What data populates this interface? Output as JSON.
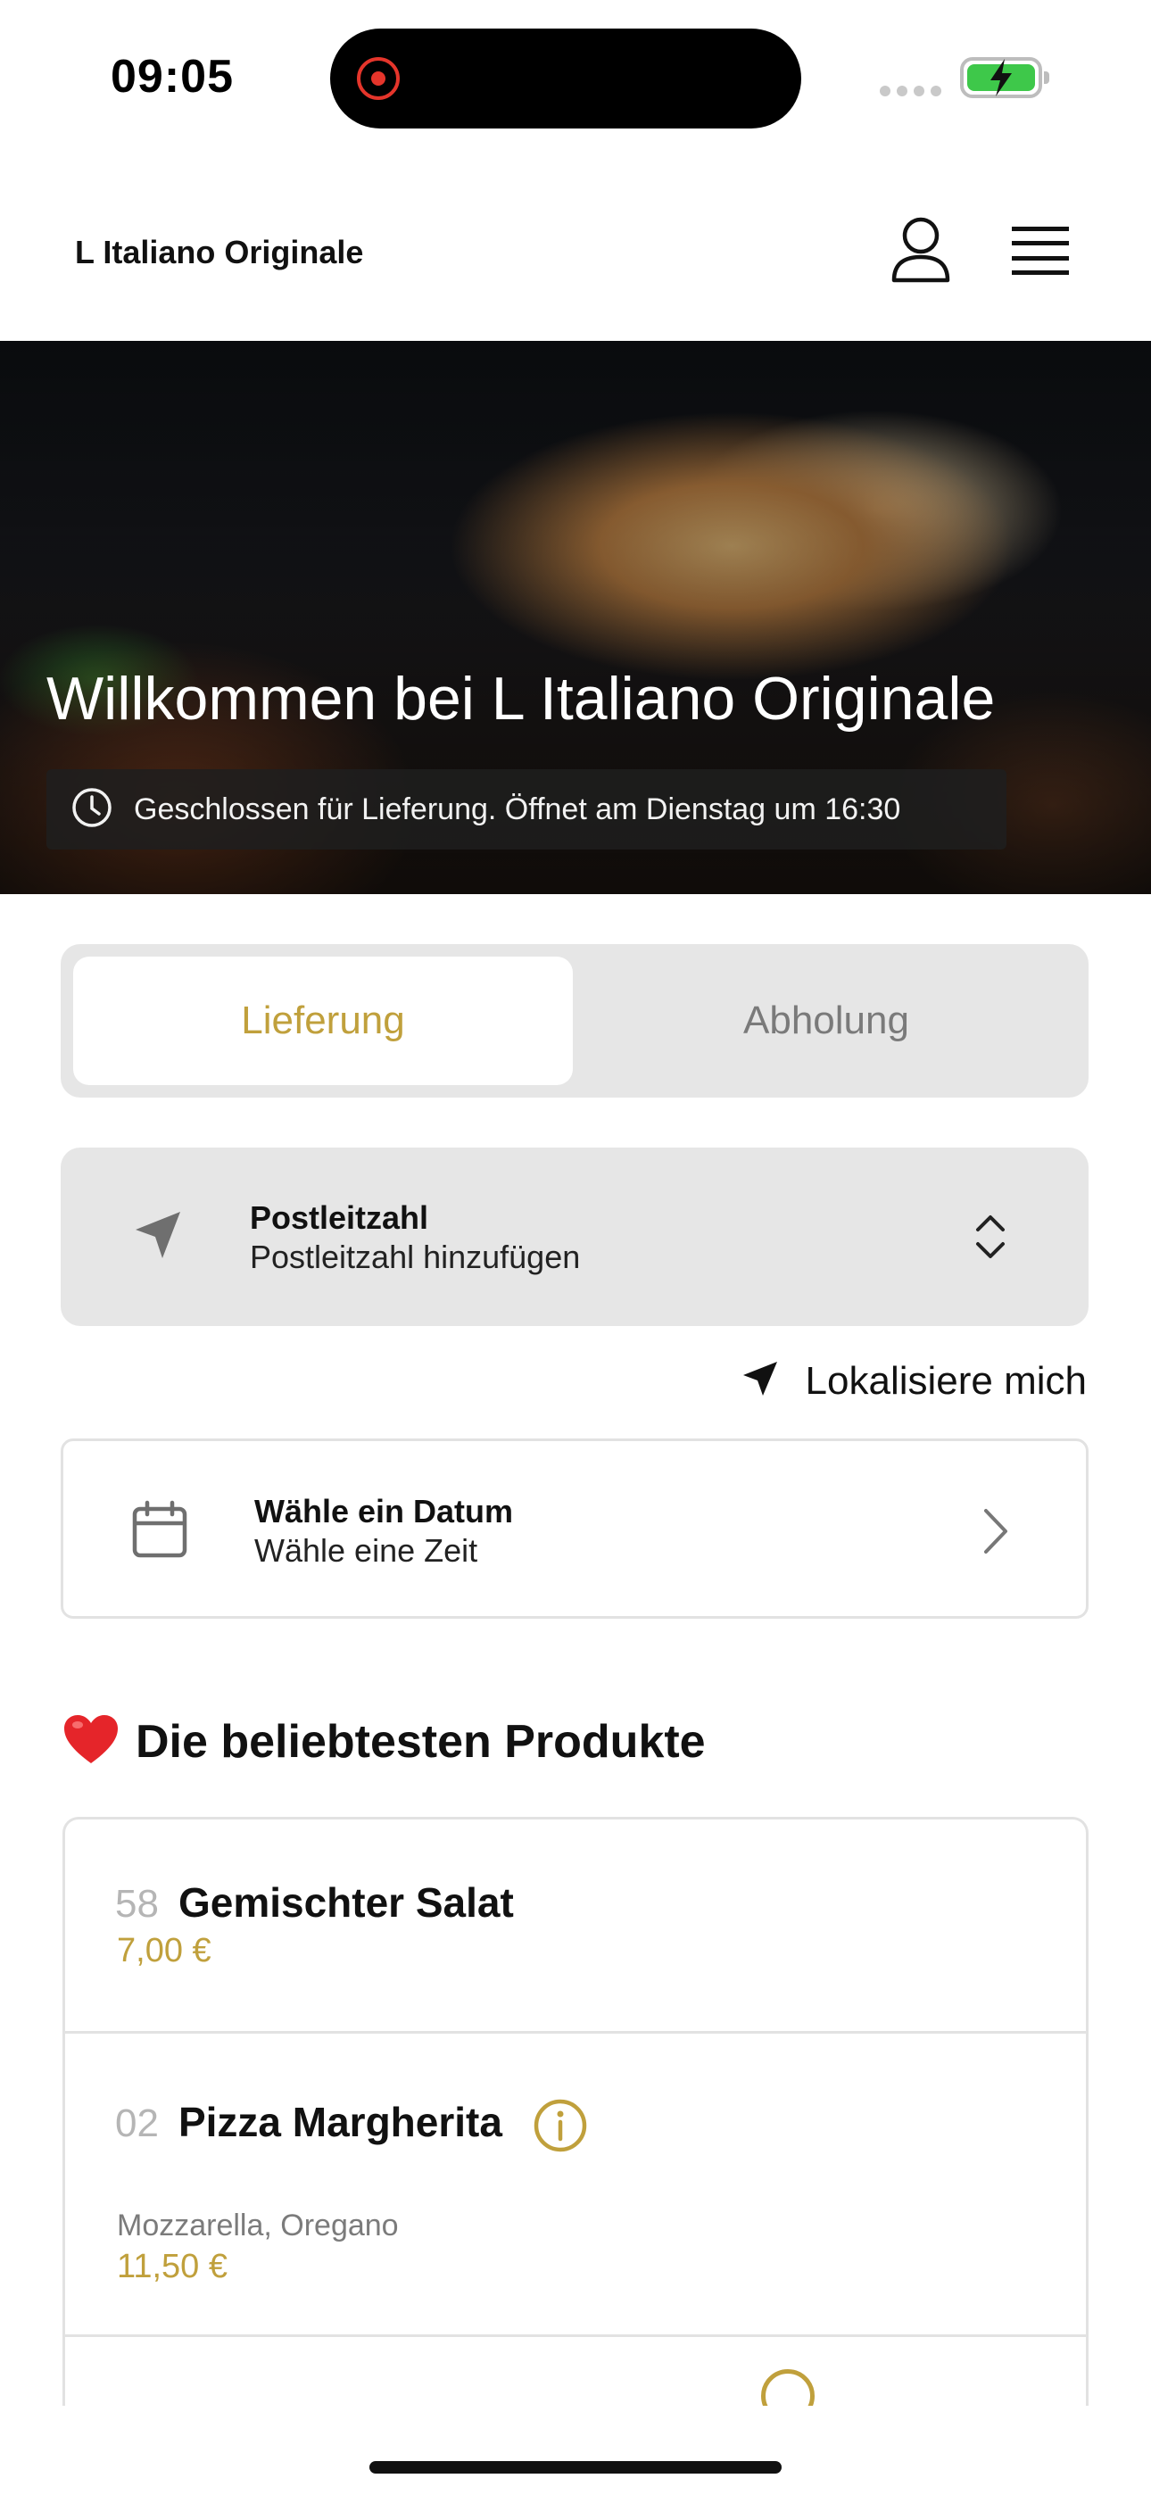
{
  "status_bar": {
    "time": "09:05"
  },
  "header": {
    "title": "L Italiano Originale"
  },
  "hero": {
    "title": "Willkommen bei L Italiano Originale",
    "status": "Geschlossen für Lieferung. Öffnet am Dienstag um 16:30"
  },
  "order_mode": {
    "tabs": [
      {
        "label": "Lieferung",
        "selected": true
      },
      {
        "label": "Abholung",
        "selected": false
      }
    ]
  },
  "postal": {
    "label": "Postleitzahl",
    "value": "Postleitzahl hinzufügen"
  },
  "locate": {
    "label": "Lokalisiere mich"
  },
  "date": {
    "label": "Wähle ein Datum",
    "value": "Wähle eine Zeit"
  },
  "popular": {
    "emoji": "❤️",
    "title": "Die beliebtesten Produkte",
    "products": [
      {
        "number": "58",
        "name": "Gemischter Salat",
        "description": "",
        "price": "7,00 €"
      },
      {
        "number": "02",
        "name": "Pizza Margherita",
        "description": "Mozzarella, Oregano",
        "price": "11,50 €"
      }
    ]
  },
  "colors": {
    "accent": "#c0a03c",
    "card_gray": "#e6e6e6",
    "border": "#e2e2e2"
  }
}
